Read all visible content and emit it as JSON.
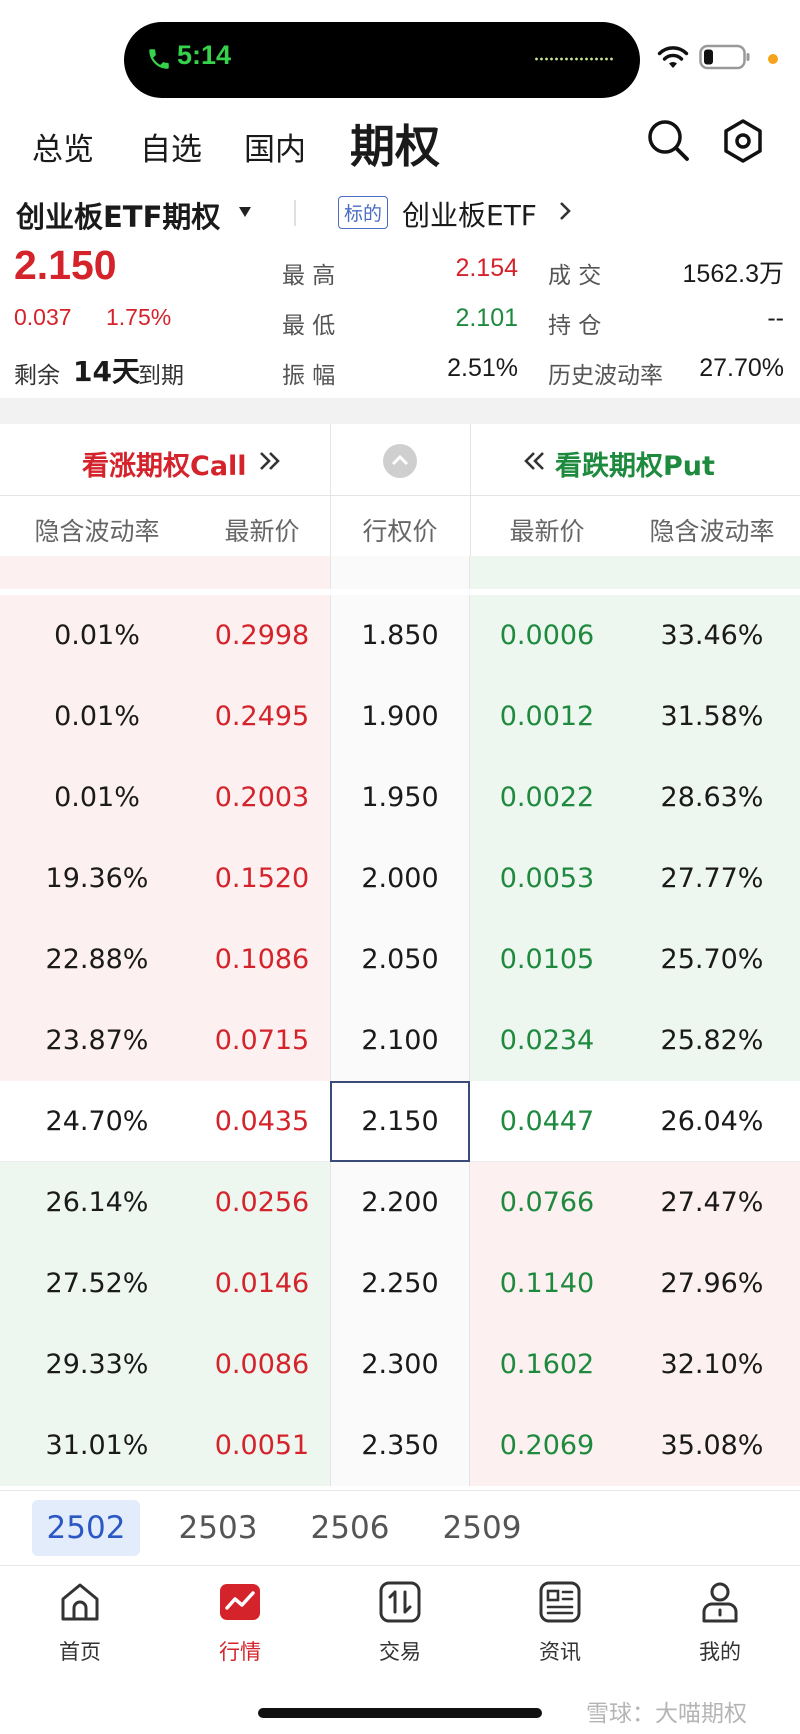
{
  "status_bar": {
    "call_time": "5:14"
  },
  "top_tabs": [
    "总览",
    "自选",
    "国内",
    "期权"
  ],
  "contract": {
    "name": "创业板ETF期权",
    "underlying_tag": "标的",
    "underlying_name": "创业板ETF"
  },
  "quote": {
    "last_price": "2.150",
    "change": "0.037",
    "change_pct": "1.75%",
    "remaining_label": "剩余",
    "remaining_days": "14天",
    "expire_label": "到期",
    "high_label": "最 高",
    "high": "2.154",
    "low_label": "最 低",
    "low": "2.101",
    "amp_label": "振 幅",
    "amplitude": "2.51%",
    "vol_label": "成 交",
    "volume": "1562.3万",
    "oi_label": "持 仓",
    "open_interest": "--",
    "hv_label": "历史波动率",
    "hist_vol": "27.70%"
  },
  "chain_header": {
    "call_title": "看涨期权Call",
    "put_title": "看跌期权Put",
    "columns": [
      "隐含波动率",
      "最新价",
      "行权价",
      "最新价",
      "隐含波动率"
    ]
  },
  "rows": [
    {
      "call_iv": "0.01%",
      "call_price": "0.2998",
      "strike": "1.850",
      "put_price": "0.0006",
      "put_iv": "33.46%"
    },
    {
      "call_iv": "0.01%",
      "call_price": "0.2495",
      "strike": "1.900",
      "put_price": "0.0012",
      "put_iv": "31.58%"
    },
    {
      "call_iv": "0.01%",
      "call_price": "0.2003",
      "strike": "1.950",
      "put_price": "0.0022",
      "put_iv": "28.63%"
    },
    {
      "call_iv": "19.36%",
      "call_price": "0.1520",
      "strike": "2.000",
      "put_price": "0.0053",
      "put_iv": "27.77%"
    },
    {
      "call_iv": "22.88%",
      "call_price": "0.1086",
      "strike": "2.050",
      "put_price": "0.0105",
      "put_iv": "25.70%"
    },
    {
      "call_iv": "23.87%",
      "call_price": "0.0715",
      "strike": "2.100",
      "put_price": "0.0234",
      "put_iv": "25.82%"
    },
    {
      "call_iv": "24.70%",
      "call_price": "0.0435",
      "strike": "2.150",
      "put_price": "0.0447",
      "put_iv": "26.04%"
    },
    {
      "call_iv": "26.14%",
      "call_price": "0.0256",
      "strike": "2.200",
      "put_price": "0.0766",
      "put_iv": "27.47%"
    },
    {
      "call_iv": "27.52%",
      "call_price": "0.0146",
      "strike": "2.250",
      "put_price": "0.1140",
      "put_iv": "27.96%"
    },
    {
      "call_iv": "29.33%",
      "call_price": "0.0086",
      "strike": "2.300",
      "put_price": "0.1602",
      "put_iv": "32.10%"
    },
    {
      "call_iv": "31.01%",
      "call_price": "0.0051",
      "strike": "2.350",
      "put_price": "0.2069",
      "put_iv": "35.08%"
    }
  ],
  "expiries": [
    "2502",
    "2503",
    "2506",
    "2509"
  ],
  "bottom_nav": [
    {
      "label": "首页",
      "icon": "home-icon"
    },
    {
      "label": "行情",
      "icon": "market-chart-icon"
    },
    {
      "label": "交易",
      "icon": "trade-icon"
    },
    {
      "label": "资讯",
      "icon": "news-icon"
    },
    {
      "label": "我的",
      "icon": "profile-icon"
    }
  ],
  "watermark": "雪球：大喵期权",
  "colors": {
    "up": "#d4232b",
    "down": "#1e8a3e",
    "accent": "#2b59c3"
  }
}
